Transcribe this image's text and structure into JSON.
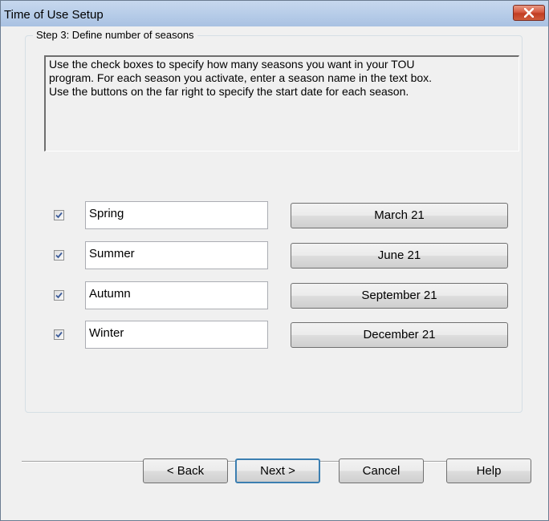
{
  "window": {
    "title": "Time of Use Setup",
    "close_icon": "close-icon"
  },
  "group": {
    "label": "Step 3: Define number of seasons",
    "instructions": [
      "Use the check boxes to specify how many seasons you want in your TOU",
      "program.  For each season you activate, enter a season name in the text box.",
      "Use the buttons on the far right to specify the start date for each season."
    ]
  },
  "seasons": [
    {
      "checked": true,
      "name": "Spring",
      "start_date": "March 21"
    },
    {
      "checked": true,
      "name": "Summer",
      "start_date": "June 21"
    },
    {
      "checked": true,
      "name": "Autumn",
      "start_date": "September 21"
    },
    {
      "checked": true,
      "name": "Winter",
      "start_date": "December 21"
    }
  ],
  "buttons": {
    "back": "< Back",
    "next": "Next >",
    "cancel": "Cancel",
    "help": "Help"
  },
  "colors": {
    "titlebar": "#b6cce8",
    "close_button": "#c13d22",
    "check_mark": "#3b5b9a",
    "default_button_border": "#3c7fb1"
  }
}
